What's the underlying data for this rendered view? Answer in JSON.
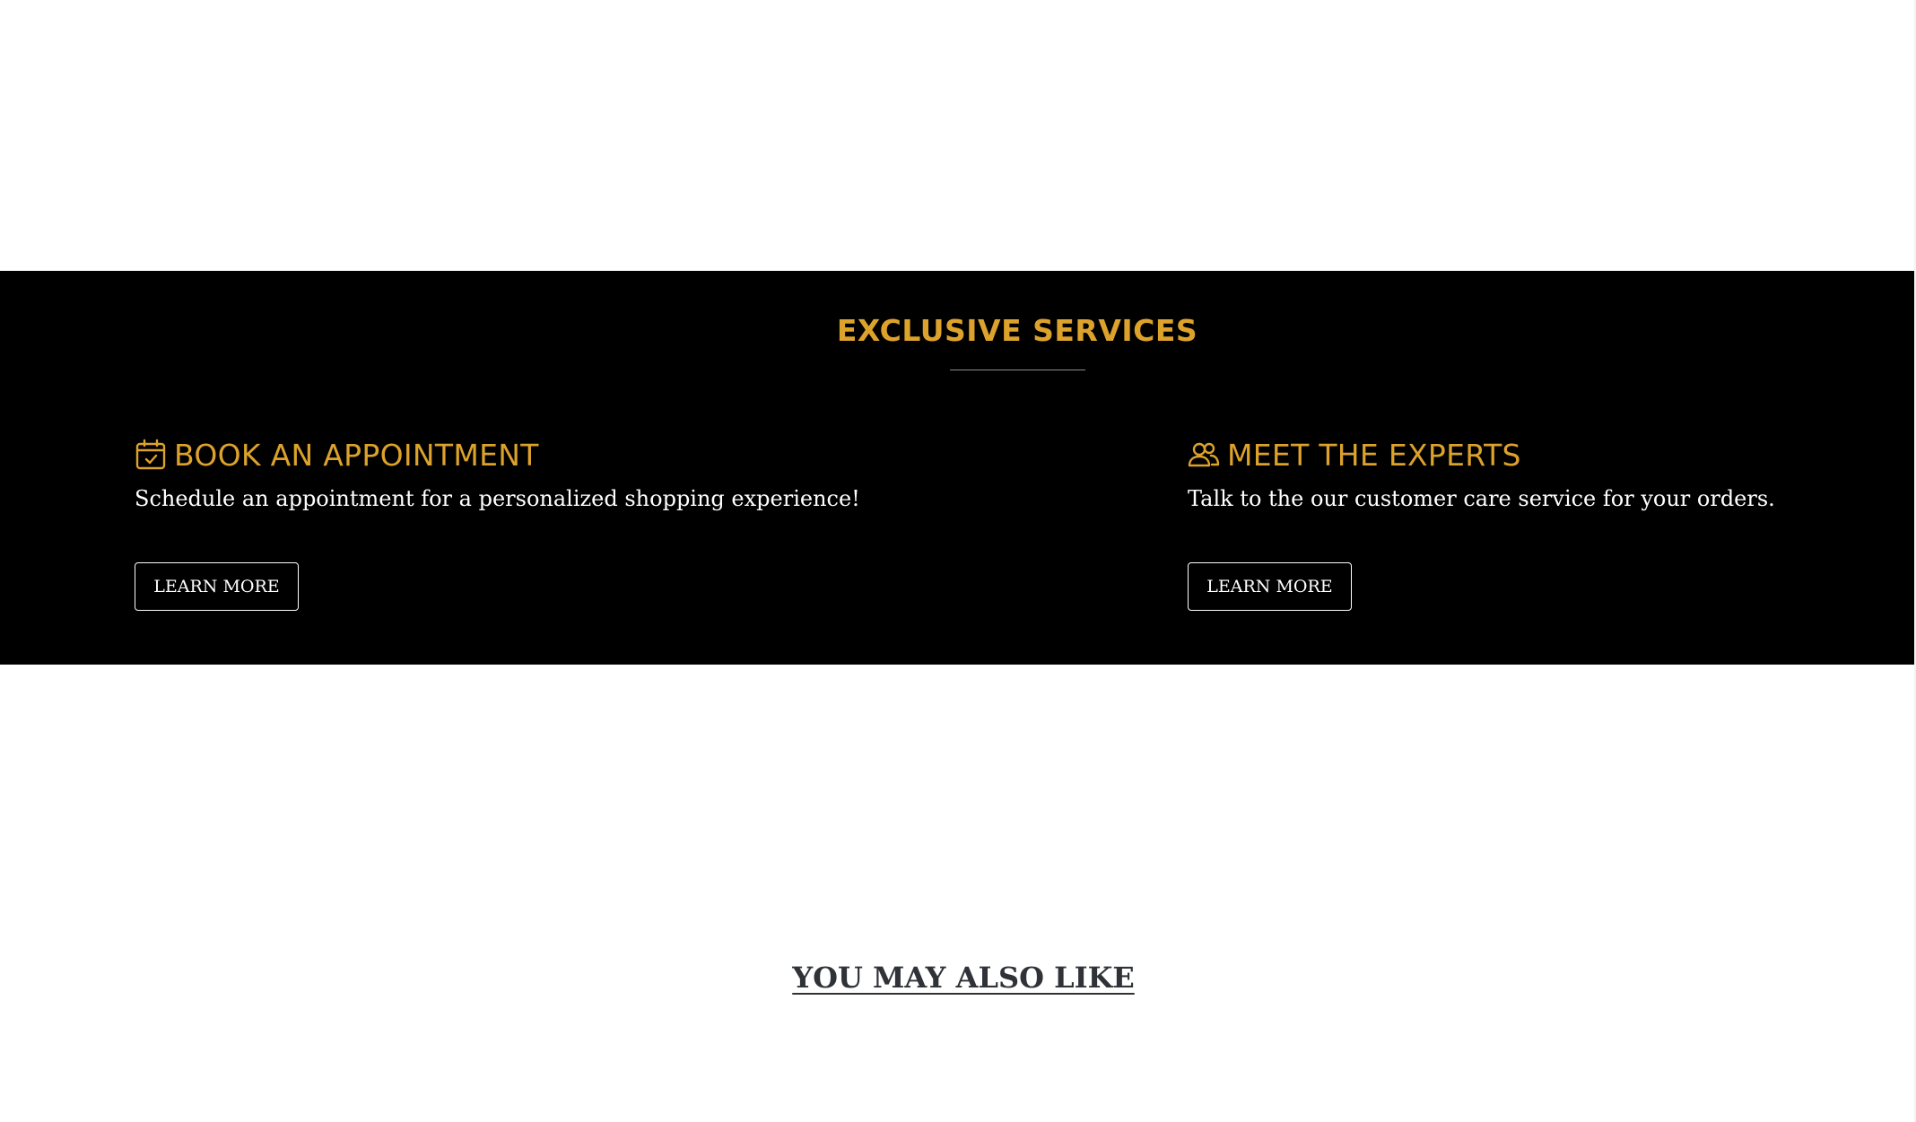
{
  "services": {
    "title": "EXCLUSIVE SERVICES",
    "accent_color": "#dca22b",
    "items": [
      {
        "icon": "calendar-check-icon",
        "title": "BOOK AN APPOINTMENT",
        "description": "Schedule an appointment for a personalized shopping experience!",
        "button_label": "LEARN MORE"
      },
      {
        "icon": "users-icon",
        "title": "MEET THE EXPERTS",
        "description": "Talk to the our customer care service for your orders.",
        "button_label": "LEARN MORE"
      }
    ]
  },
  "recommendations": {
    "title": "YOU MAY ALSO LIKE"
  }
}
